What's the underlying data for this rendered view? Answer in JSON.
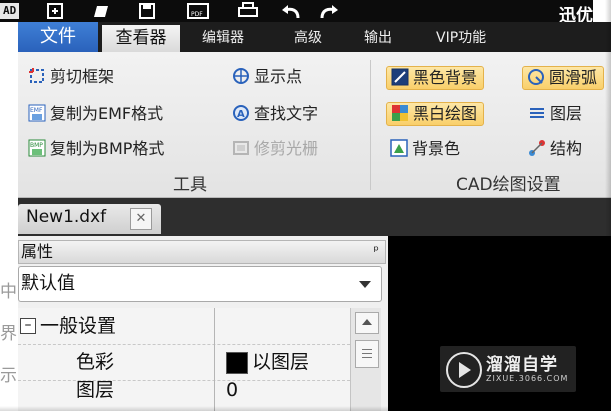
{
  "titlebar": {
    "app_badge": "AD",
    "right_text": "迅优"
  },
  "menubar": {
    "file_tab": "文件",
    "active_tab": "查看器",
    "tabs": [
      "编辑器",
      "高级",
      "输出",
      "VIP功能"
    ]
  },
  "ribbon": {
    "tools_group": {
      "label": "工具",
      "buttons": [
        {
          "label": "剪切框架",
          "icon": "crop-frame-icon"
        },
        {
          "label": "复制为EMF格式",
          "icon": "emf-copy-icon"
        },
        {
          "label": "复制为BMP格式",
          "icon": "bmp-copy-icon"
        },
        {
          "label": "显示点",
          "icon": "show-points-icon"
        },
        {
          "label": "查找文字",
          "icon": "find-text-icon"
        },
        {
          "label": "修剪光栅",
          "icon": "trim-raster-icon",
          "disabled": true
        }
      ]
    },
    "cad_settings_group": {
      "label": "CAD绘图设置",
      "buttons": [
        {
          "label": "黑色背景",
          "icon": "black-background-icon",
          "active": true
        },
        {
          "label": "黑白绘图",
          "icon": "black-white-drawing-icon",
          "active": true
        },
        {
          "label": "背景色",
          "icon": "background-color-icon"
        },
        {
          "label": "圆滑弧",
          "icon": "smooth-arc-icon",
          "active": true
        },
        {
          "label": "图层",
          "icon": "layers-icon"
        },
        {
          "label": "结构",
          "icon": "structure-icon"
        }
      ]
    }
  },
  "document_tab": {
    "name": "New1.dxf",
    "close_glyph": "✕"
  },
  "properties": {
    "title": "属性",
    "pin_glyph": "ᵖ",
    "dropdown_value": "默认值",
    "rows": [
      {
        "label": "一般设置",
        "expander": "–",
        "value": ""
      },
      {
        "label": "色彩",
        "value": "以图层",
        "swatch": "#000000"
      },
      {
        "label": "图层",
        "value": "0"
      }
    ]
  },
  "left_edge_fragments": [
    "中",
    "界",
    "示"
  ],
  "watermark": {
    "title": "溜溜自学",
    "url": "ZIXUE.3066.COM"
  },
  "colors": {
    "titlebar_bg": "#0c0c0c",
    "file_tab_blue": "#2a62bb",
    "highlight_gold": "#f9cf6a",
    "canvas_bg": "#000000"
  }
}
